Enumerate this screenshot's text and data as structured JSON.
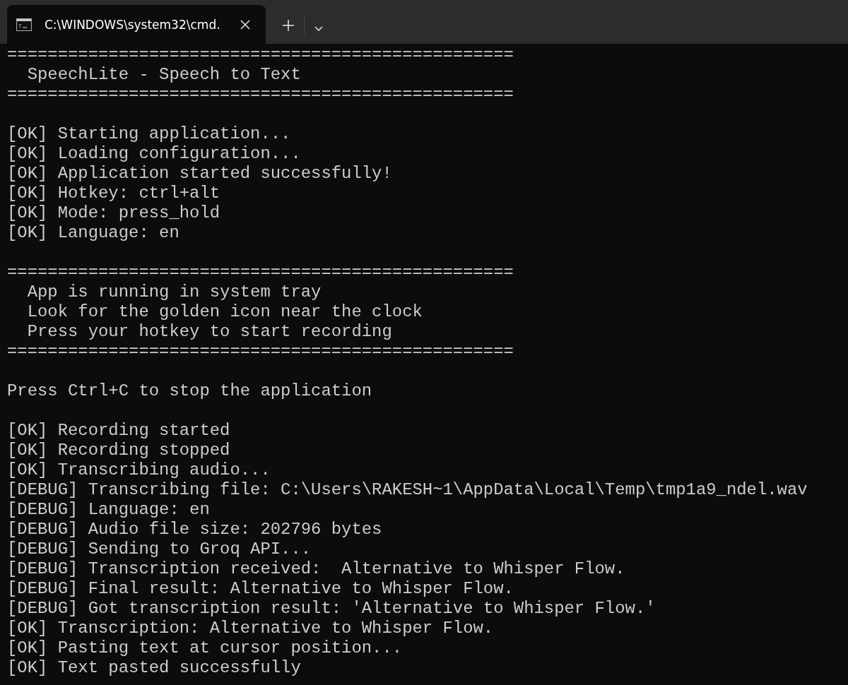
{
  "tab": {
    "title": "C:\\WINDOWS\\system32\\cmd.",
    "selected": true
  },
  "console": {
    "blocks": [
      {
        "lines": [
          "==================================================",
          "  SpeechLite - Speech to Text",
          "=================================================="
        ]
      },
      {
        "lines": [
          "[OK] Starting application...",
          "[OK] Loading configuration...",
          "[OK] Application started successfully!",
          "[OK] Hotkey: ctrl+alt",
          "[OK] Mode: press_hold",
          "[OK] Language: en"
        ]
      },
      {
        "lines": [
          "==================================================",
          "  App is running in system tray",
          "  Look for the golden icon near the clock",
          "  Press your hotkey to start recording",
          "=================================================="
        ]
      },
      {
        "lines": [
          "Press Ctrl+C to stop the application"
        ]
      },
      {
        "lines": [
          "[OK] Recording started",
          "[OK] Recording stopped",
          "[OK] Transcribing audio...",
          "[DEBUG] Transcribing file: C:\\Users\\RAKESH~1\\AppData\\Local\\Temp\\tmp1a9_ndel.wav",
          "[DEBUG] Language: en",
          "[DEBUG] Audio file size: 202796 bytes",
          "[DEBUG] Sending to Groq API...",
          "[DEBUG] Transcription received:  Alternative to Whisper Flow.",
          "[DEBUG] Final result: Alternative to Whisper Flow.",
          "[DEBUG] Got transcription result: 'Alternative to Whisper Flow.'",
          "[OK] Transcription: Alternative to Whisper Flow.",
          "[OK] Pasting text at cursor position...",
          "[OK] Text pasted successfully"
        ]
      }
    ]
  }
}
